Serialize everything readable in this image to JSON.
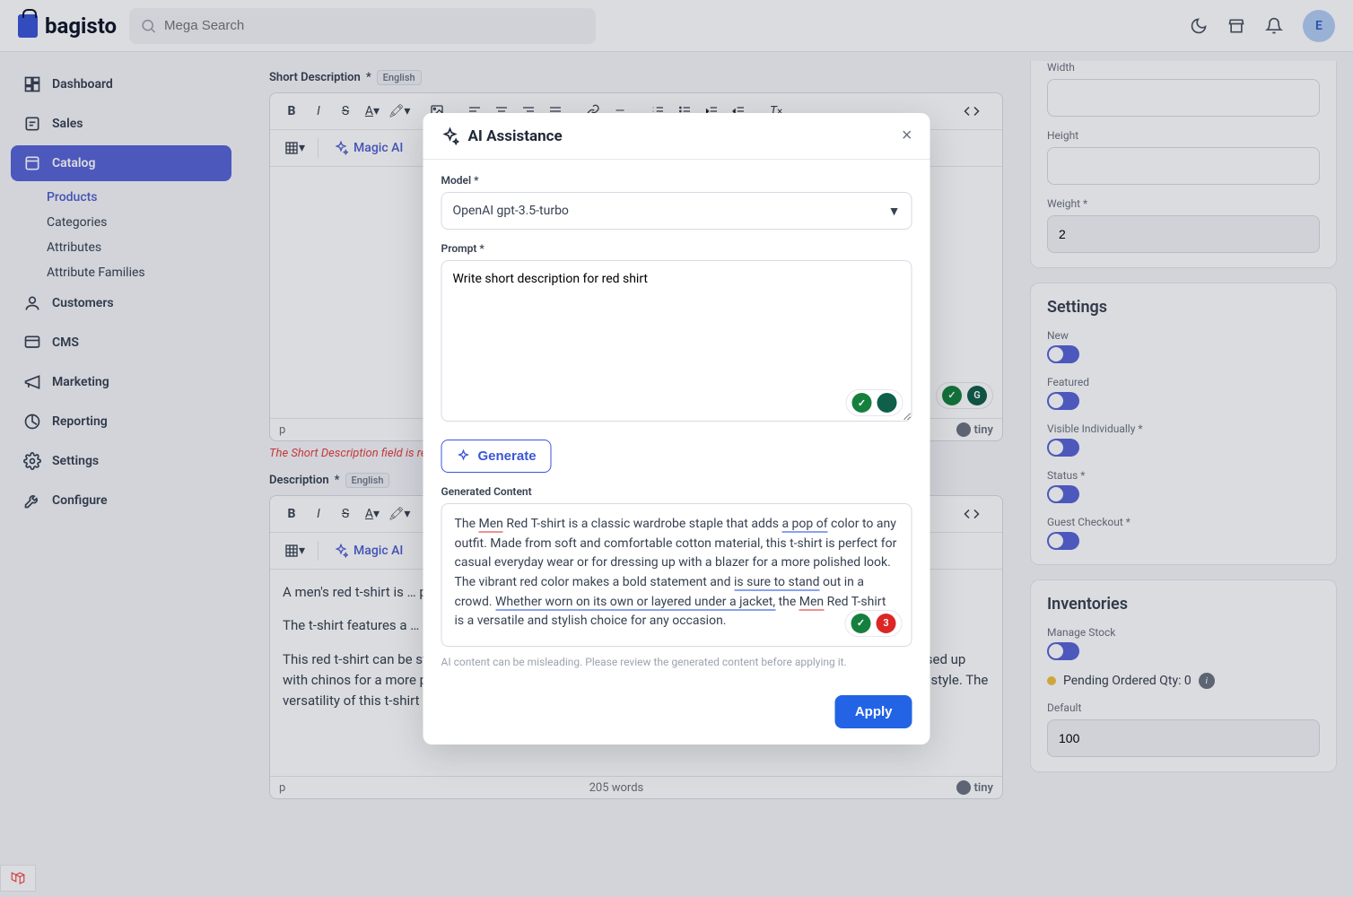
{
  "brand": "bagisto",
  "search": {
    "placeholder": "Mega Search"
  },
  "avatar_initial": "E",
  "sidebar": {
    "items": [
      {
        "label": "Dashboard",
        "icon": "dashboard"
      },
      {
        "label": "Sales",
        "icon": "sales"
      },
      {
        "label": "Catalog",
        "icon": "catalog",
        "active": true,
        "children": [
          {
            "label": "Products",
            "active": true
          },
          {
            "label": "Categories"
          },
          {
            "label": "Attributes"
          },
          {
            "label": "Attribute Families"
          }
        ]
      },
      {
        "label": "Customers",
        "icon": "customers"
      },
      {
        "label": "CMS",
        "icon": "cms"
      },
      {
        "label": "Marketing",
        "icon": "marketing"
      },
      {
        "label": "Reporting",
        "icon": "reporting"
      },
      {
        "label": "Settings",
        "icon": "settings"
      },
      {
        "label": "Configure",
        "icon": "configure"
      }
    ]
  },
  "form": {
    "short_desc_label": "Short Description",
    "short_desc_required": "*",
    "lang": "English",
    "magic_ai_label": "Magic AI",
    "short_desc_path": "p",
    "short_desc_error": "The Short Description field is required",
    "desc_label": "Description",
    "desc_required": "*",
    "desc_body_p1": "A men's red t-shirt is … particular t-shirt is m… long. The vibrant red … flair to a casual look.",
    "desc_body_p2": "The t-shirt features a … is durable and easy to c… vibrant, adding a tou…",
    "desc_body_p3": "This red t-shirt can be styled in numerous ways, whether paired with jeans for a casual weekend look or dressed up with chinos for a more polished outfit. It can also be layered under a jacket or sweater for added warmth and style. The versatility of this t-shirt makes it a must-have piece in any man's wardrobe.",
    "desc_path": "p",
    "word_count": "205 words",
    "tiny": "tiny"
  },
  "rightpanel": {
    "width_label": "Width",
    "height_label": "Height",
    "weight_label": "Weight",
    "weight_required": "*",
    "weight_value": "2",
    "settings_title": "Settings",
    "settings": [
      {
        "label": "New",
        "required": ""
      },
      {
        "label": "Featured",
        "required": ""
      },
      {
        "label": "Visible Individually",
        "required": "*"
      },
      {
        "label": "Status",
        "required": "*"
      },
      {
        "label": "Guest Checkout",
        "required": "*"
      }
    ],
    "inventories_title": "Inventories",
    "manage_stock_label": "Manage Stock",
    "pending_label": "Pending Ordered Qty: 0",
    "default_label": "Default",
    "default_value": "100"
  },
  "modal": {
    "title": "AI Assistance",
    "model_label": "Model",
    "model_required": "*",
    "model_value": "OpenAI gpt-3.5-turbo",
    "prompt_label": "Prompt",
    "prompt_required": "*",
    "prompt_value": "Write short description for red shirt",
    "generate_label": "Generate",
    "generated_label": "Generated Content",
    "generated_content": {
      "pre1": "The ",
      "u1": "Men",
      "t2": " Red T-shirt is a classic wardrobe staple that adds ",
      "u2": "a pop of",
      "t3": " color to any outfit. Made from soft and comfortable cotton material, this t-shirt is perfect for casual everyday wear or for dressing up with a blazer for a more polished look. The vibrant red color makes a bold statement and ",
      "u3": "is sure to stand",
      "t4": " out in a crowd. ",
      "u4": "Whether worn on its own or layered under a jacket,",
      "t5": " the ",
      "u5": "Men",
      "t6": " Red T-shirt is a versatile and stylish choice for any occasion."
    },
    "grammar_badge_count": "3",
    "disclaimer": "AI content can be misleading. Please review the generated content before applying it.",
    "apply_label": "Apply"
  }
}
